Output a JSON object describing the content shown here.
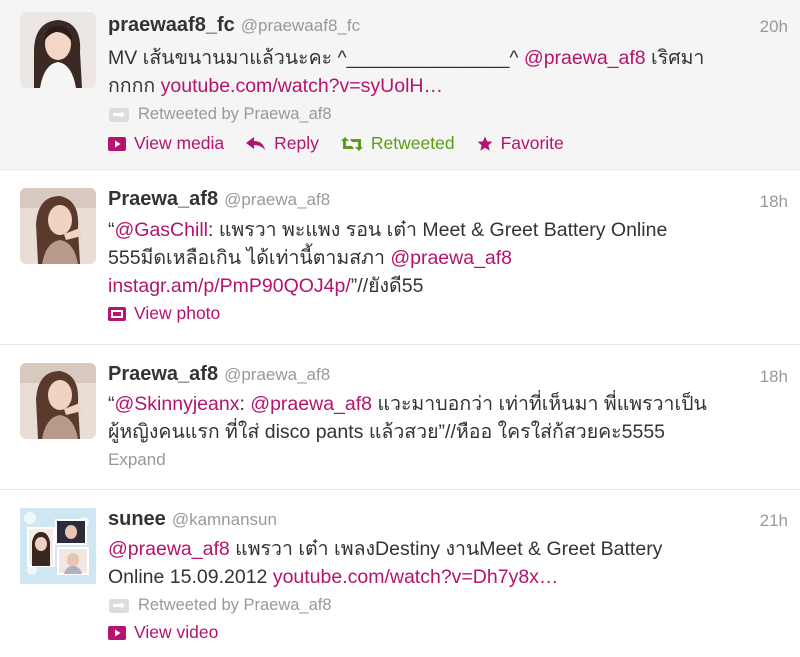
{
  "colors": {
    "link": "#b4136e",
    "retweeted": "#5c9c1a",
    "muted": "#999999",
    "text": "#333333"
  },
  "tweets": [
    {
      "name": "praewaaf8_fc",
      "handle": "@praewaaf8_fc",
      "time": "20h",
      "text_line1_a": "MV เส้นขนานมาแล้วนะคะ ^_______________^ ",
      "mention": "@praewa_af8",
      "text_line1_b": " เริศมา",
      "text_line2_a": "กกกก ",
      "url": "youtube.com/watch?v=syUolH…",
      "retweeted_by": "Retweeted by Praewa_af8",
      "actions": {
        "view_media": "View media",
        "reply": "Reply",
        "retweeted": "Retweeted",
        "favorite": "Favorite"
      }
    },
    {
      "name": "Praewa_af8",
      "handle": "@praewa_af8",
      "time": "18h",
      "quote_open": "“",
      "mention1": "@GasChill",
      "text_line1": ": แพรวา พะแพง รอน เต๋า Meet & Greet Battery Online",
      "text_line2": "555มีดเหลือเกิน ได้เท่านี้ตามสภา ",
      "mention2": "@praewa_af8",
      "url": "instagr.am/p/PmP90QOJ4p/",
      "text_line3_end": "”//ยังดี55",
      "view_photo": "View photo"
    },
    {
      "name": "Praewa_af8",
      "handle": "@praewa_af8",
      "time": "18h",
      "quote_open": "“",
      "mention1": "@Skinnyjeanx",
      "colon": ": ",
      "mention2": "@praewa_af8",
      "text_line1": " แวะมาบอกว่า เท่าที่เห็นมา พี่แพรวาเป็น",
      "text_line2": "ผู้หญิงคนแรก ที่ใส่ disco pants แล้วสวย”//หืออ ใครใส่ก้สวยคะ5555",
      "expand": "Expand"
    },
    {
      "name": "sunee",
      "handle": "@kamnansun",
      "time": "21h",
      "mention": "@praewa_af8",
      "text_line1": " แพรวา เต๋า เพลงDestiny งานMeet & Greet Battery",
      "text_line2_a": "Online 15.09.2012 ",
      "url": "youtube.com/watch?v=Dh7y8x…",
      "retweeted_by": "Retweeted by Praewa_af8",
      "view_video": "View video"
    }
  ]
}
